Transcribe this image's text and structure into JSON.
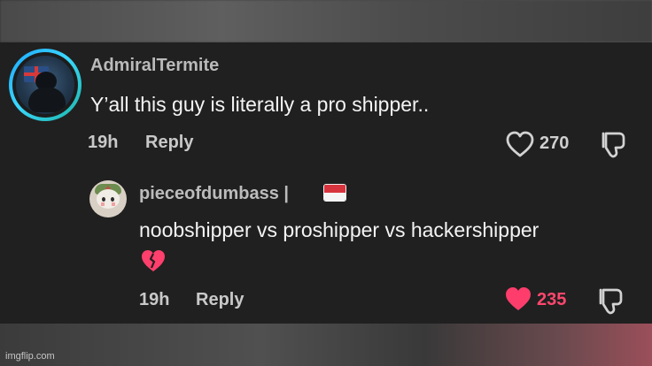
{
  "main_comment": {
    "username": "AdmiralTermite",
    "text": "Y’all this guy is literally a pro shipper..",
    "time": "19h",
    "reply_label": "Reply",
    "likes": "270",
    "liked": false,
    "avatar_icon": "soldier-avatar-icon",
    "like_icon": "heart-outline-icon",
    "dislike_icon": "thumbs-down-icon"
  },
  "reply_comment": {
    "username": "pieceofdumbass |",
    "text": "noobshipper vs proshipper vs hackershipper",
    "time": "19h",
    "reply_label": "Reply",
    "likes": "235",
    "liked": true,
    "avatar_icon": "anime-avatar-icon",
    "flag_icon": "indonesia-flag-icon",
    "emoji_icon": "broken-heart-icon",
    "like_icon": "heart-filled-icon",
    "dislike_icon": "thumbs-down-icon"
  },
  "watermark": "imgflip.com",
  "colors": {
    "background": "#202020",
    "username": "#bababa",
    "text": "#f4f4f4",
    "meta": "#c9c9c9",
    "like_active": "#ff476d",
    "avatar_ring": "#2cc6ff",
    "broken_heart": "#ff3f6c"
  }
}
